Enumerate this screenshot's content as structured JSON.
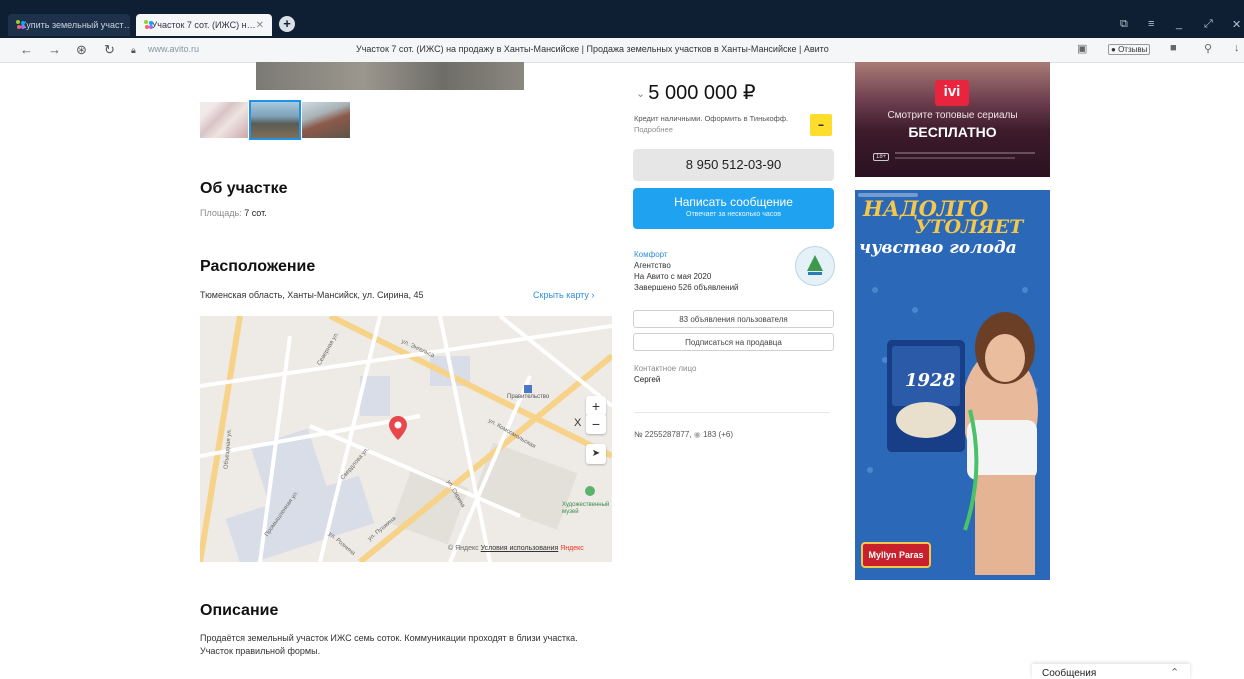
{
  "browser": {
    "tabs": [
      {
        "label": "Купить земельный участ…",
        "active": false
      },
      {
        "label": "Участок 7 сот. (ИЖС) н…",
        "active": true
      }
    ],
    "url": "www.avito.ru",
    "page_title": "Участок 7 сот. (ИЖС) на продажу в Ханты-Мансийске | Продажа земельных участков в Ханты-Мансийске | Авито",
    "reviews_label": "Отзывы"
  },
  "about": {
    "title": "Об участке",
    "area_label": "Площадь:",
    "area_value": "7 сот."
  },
  "location": {
    "title": "Расположение",
    "address": "Тюменская область, Ханты-Мансийск, ул. Сирина, 45",
    "hide_map": "Скрыть карту"
  },
  "map": {
    "street_labels": [
      "ул. Энгельса",
      "ул. Комсомольская",
      "Промышленная ул.",
      "ул. Сирина",
      "Объездная ул.",
      "Северная ул.",
      "Свердлова ул.",
      "ул. Пушкина",
      "ул. Рознина"
    ],
    "poi_labels": [
      "Правительство",
      "Художественный музей"
    ],
    "city_label": "Х",
    "copyright": "© Яндекс",
    "terms": "Условия использования",
    "brand": "Яндекс"
  },
  "description": {
    "title": "Описание",
    "text": "Продаётся земельный участок ИЖС семь соток. Коммуникации проходят в близи участка. Участок правильной формы."
  },
  "offer": {
    "price": "5 000 000 ₽",
    "credit_text": "Кредит наличными. Оформить в Тинькофф.",
    "credit_more": "Подробнее",
    "phone": "8 950 512-03-90",
    "message_btn": "Написать сообщение",
    "message_sub": "Отвечает за несколько часов"
  },
  "seller": {
    "name": "Комфорт",
    "type": "Агентство",
    "since": "На Авито с мая 2020",
    "completed": "Завершено 526 объявлений",
    "ads_btn": "83 объявления пользователя",
    "subscribe_btn": "Подписаться на продавца",
    "contact_label": "Контактное лицо",
    "contact_name": "Сергей"
  },
  "listing": {
    "number": "№ 2255287877,",
    "views": "183 (+6)"
  },
  "ads": {
    "ad1": {
      "brand": "ivi",
      "line1": "Смотрите топовые сериалы",
      "line2": "БЕСПЛАТНО",
      "age": "18+"
    },
    "ad2": {
      "line1": "НАДОЛГО",
      "line2": "УТОЛЯЕТ",
      "line3": "чувство голода",
      "product": "1928",
      "brand": "Myllyn Paras"
    }
  },
  "messages_panel": {
    "label": "Сообщения"
  },
  "colors": {
    "accent": "#1fa3f0",
    "link": "#2d8fe0",
    "pin": "#e8474c"
  }
}
